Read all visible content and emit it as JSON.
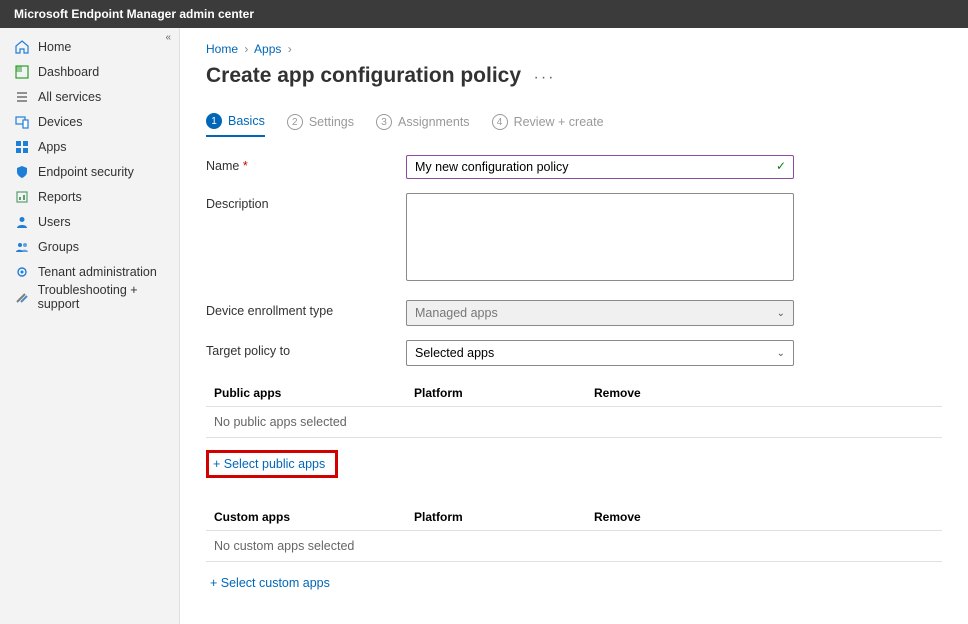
{
  "topbar": {
    "title": "Microsoft Endpoint Manager admin center"
  },
  "sidebar": {
    "items": [
      {
        "label": "Home",
        "icon": "home"
      },
      {
        "label": "Dashboard",
        "icon": "dashboard"
      },
      {
        "label": "All services",
        "icon": "list"
      },
      {
        "label": "Devices",
        "icon": "devices"
      },
      {
        "label": "Apps",
        "icon": "grid"
      },
      {
        "label": "Endpoint security",
        "icon": "shield"
      },
      {
        "label": "Reports",
        "icon": "report"
      },
      {
        "label": "Users",
        "icon": "user"
      },
      {
        "label": "Groups",
        "icon": "group"
      },
      {
        "label": "Tenant administration",
        "icon": "gear"
      },
      {
        "label": "Troubleshooting + support",
        "icon": "wrench"
      }
    ]
  },
  "breadcrumb": {
    "a": "Home",
    "b": "Apps"
  },
  "page": {
    "title": "Create app configuration policy"
  },
  "steps": {
    "s1": {
      "num": "1",
      "label": "Basics"
    },
    "s2": {
      "num": "2",
      "label": "Settings"
    },
    "s3": {
      "num": "3",
      "label": "Assignments"
    },
    "s4": {
      "num": "4",
      "label": "Review + create"
    }
  },
  "form": {
    "name_label": "Name",
    "name_value": "My new configuration policy",
    "desc_label": "Description",
    "desc_value": "",
    "det_label": "Device enrollment type",
    "det_value": "Managed apps",
    "target_label": "Target policy to",
    "target_value": "Selected apps"
  },
  "public": {
    "head": "Public apps",
    "col2": "Platform",
    "col3": "Remove",
    "empty": "No public apps selected",
    "add": "+ Select public apps"
  },
  "custom": {
    "head": "Custom apps",
    "col2": "Platform",
    "col3": "Remove",
    "empty": "No custom apps selected",
    "add": "+ Select custom apps"
  }
}
